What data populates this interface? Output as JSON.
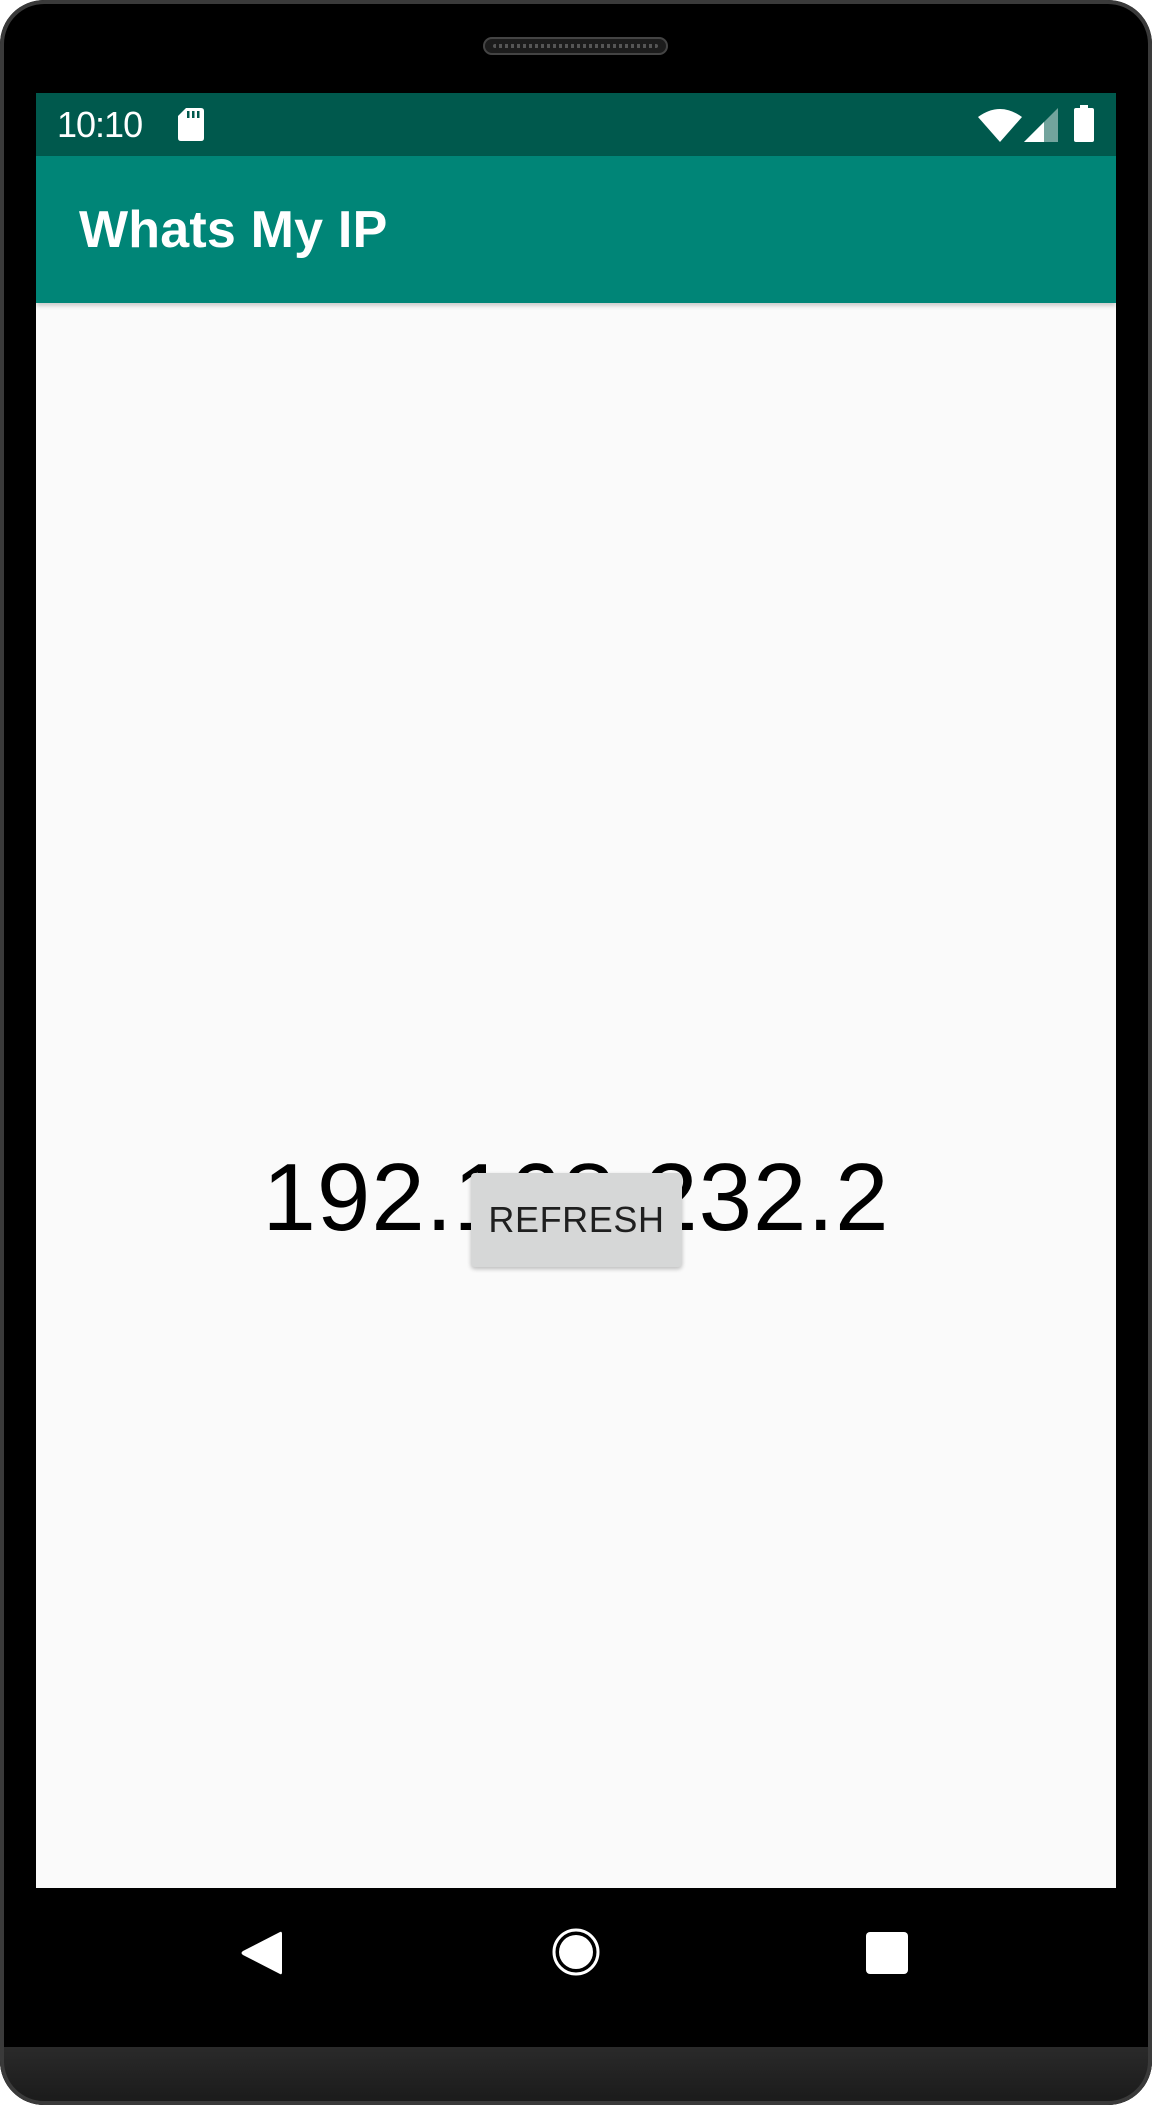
{
  "status_bar": {
    "time": "10:10",
    "icons": [
      "sd-card-icon",
      "wifi-icon",
      "cellular-signal-icon",
      "battery-icon"
    ]
  },
  "app_bar": {
    "title": "Whats My IP",
    "color": "#008577",
    "status_color": "#00594d"
  },
  "main": {
    "ip_address": "192.168.232.2",
    "refresh_label": "REFRESH"
  },
  "nav_bar": {
    "buttons": [
      "back-icon",
      "home-icon",
      "recents-icon"
    ]
  }
}
